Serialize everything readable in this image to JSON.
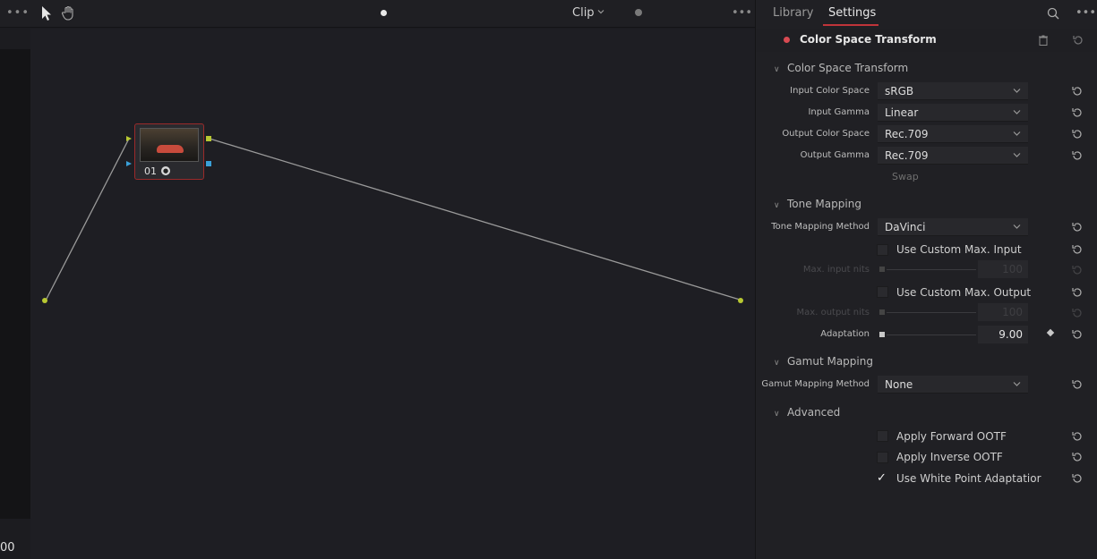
{
  "toolbar": {
    "menu_dots": "•••",
    "clip_label": "Clip",
    "more_dots": "•••"
  },
  "canvas": {
    "node_label": "01",
    "left_number": "00"
  },
  "tabs": {
    "library": "Library",
    "settings": "Settings",
    "more_dots": "•••"
  },
  "effect": {
    "title": "Color Space Transform"
  },
  "sections": {
    "cst": "Color Space Transform",
    "tone": "Tone Mapping",
    "gamut": "Gamut Mapping",
    "advanced": "Advanced"
  },
  "params": {
    "input_color_space": {
      "label": "Input Color Space",
      "value": "sRGB"
    },
    "input_gamma": {
      "label": "Input Gamma",
      "value": "Linear"
    },
    "output_color_space": {
      "label": "Output Color Space",
      "value": "Rec.709"
    },
    "output_gamma": {
      "label": "Output Gamma",
      "value": "Rec.709"
    },
    "swap": "Swap",
    "tone_mapping_method": {
      "label": "Tone Mapping Method",
      "value": "DaVinci"
    },
    "use_custom_max_input": "Use Custom Max. Input",
    "max_input": {
      "label": "Max. input nits",
      "value": "100"
    },
    "use_custom_max_output": "Use Custom Max. Output",
    "max_output": {
      "label": "Max. output nits",
      "value": "100"
    },
    "adaptation": {
      "label": "Adaptation",
      "value": "9.00"
    },
    "gamut_mapping_method": {
      "label": "Gamut Mapping Method",
      "value": "None"
    },
    "apply_forward_ootf": "Apply Forward OOTF",
    "apply_inverse_ootf": "Apply Inverse OOTF",
    "use_white_point_adaptation": "Use White Point Adaptatior",
    "check_mark": "✓"
  },
  "colors": {
    "accent": "#c0343a",
    "port_green": "#b8c832",
    "port_blue": "#3aa0d8"
  }
}
